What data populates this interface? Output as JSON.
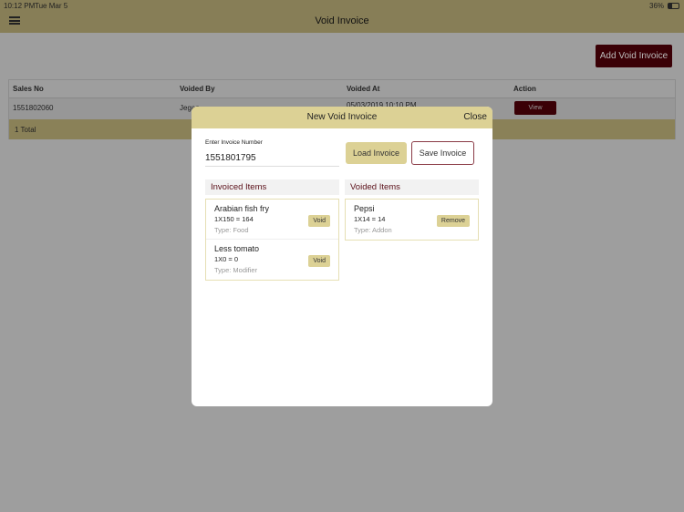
{
  "status_bar": {
    "time": "10:12 PM",
    "date": "Tue Mar 5",
    "battery": "36%"
  },
  "header": {
    "title": "Void Invoice"
  },
  "add_button": "Add Void Invoice",
  "table": {
    "columns": [
      "Sales No",
      "Voided By",
      "Voided At",
      "Action"
    ],
    "rows": [
      {
        "sales_no": "1551802060",
        "voided_by": "Jegan",
        "voided_at": "05/03/2019 10:10 PM",
        "action": "View"
      }
    ],
    "total": "1 Total"
  },
  "modal": {
    "title": "New Void Invoice",
    "close": "Close",
    "invoice_label": "Enter Invoice Number",
    "invoice_value": "1551801795",
    "load_button": "Load Invoice",
    "save_button": "Save Invoice",
    "invoiced_title": "Invoiced Items",
    "voided_title": "Voided Items",
    "invoiced_items": [
      {
        "name": "Arabian fish fry",
        "qty": "1X150 = 164",
        "type": "Type: Food",
        "action": "Void"
      },
      {
        "name": "Less tomato",
        "qty": "1X0 = 0",
        "type": "Type: Modifier",
        "action": "Void"
      }
    ],
    "voided_items": [
      {
        "name": "Pepsi",
        "qty": "1X14 = 14",
        "type": "Type: Addon",
        "action": "Remove"
      }
    ]
  },
  "colors": {
    "header": "#dcd195",
    "accent": "#3a0006",
    "section_text": "#5a0f18"
  }
}
